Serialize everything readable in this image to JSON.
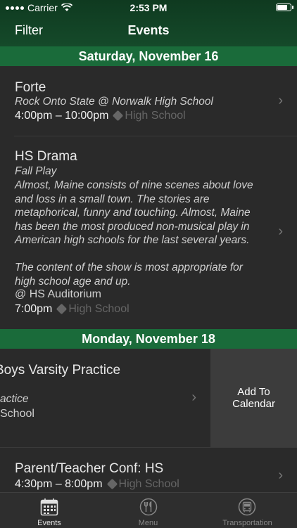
{
  "status": {
    "carrier": "Carrier",
    "time": "2:53 PM"
  },
  "nav": {
    "filter": "Filter",
    "title": "Events"
  },
  "sections": [
    {
      "title": "Saturday, November 16"
    },
    {
      "title": "Monday, November 18"
    }
  ],
  "events": [
    {
      "title": "Forte",
      "subtitle": "Rock Onto State @ Norwalk High School",
      "time": "4:00pm – 10:00pm",
      "tag": "High School"
    },
    {
      "title": "HS Drama",
      "subtitle": "Fall Play",
      "desc1": "Almost, Maine consists of nine scenes about love",
      "desc2": "and loss in a small town. The stories are",
      "desc3": "metaphorical, funny and touching. Almost, Maine",
      "desc4": "has been the most produced non-musical play in",
      "desc5": "American high schools for the last several years.",
      "desc6": "The content of the show is most appropriate for",
      "desc7": "high school age and up.",
      "location": "@ HS Auditorium",
      "time": "7:00pm",
      "tag": "High School"
    },
    {
      "title": "Boys Varsity Practice",
      "subtitle": "actice",
      "tag": "School",
      "action": "Add To Calendar"
    },
    {
      "title": "Parent/Teacher Conf: HS",
      "time": "4:30pm – 8:00pm",
      "tag": "High School"
    }
  ],
  "tabs": [
    {
      "label": "Events",
      "icon": "calendar-icon",
      "active": true
    },
    {
      "label": "Menu",
      "icon": "utensils-icon",
      "active": false
    },
    {
      "label": "Transportation",
      "icon": "bus-icon",
      "active": false
    }
  ],
  "colors": {
    "header": "#154a2a",
    "section": "#1a6b3a",
    "background": "#2a2a2a"
  }
}
